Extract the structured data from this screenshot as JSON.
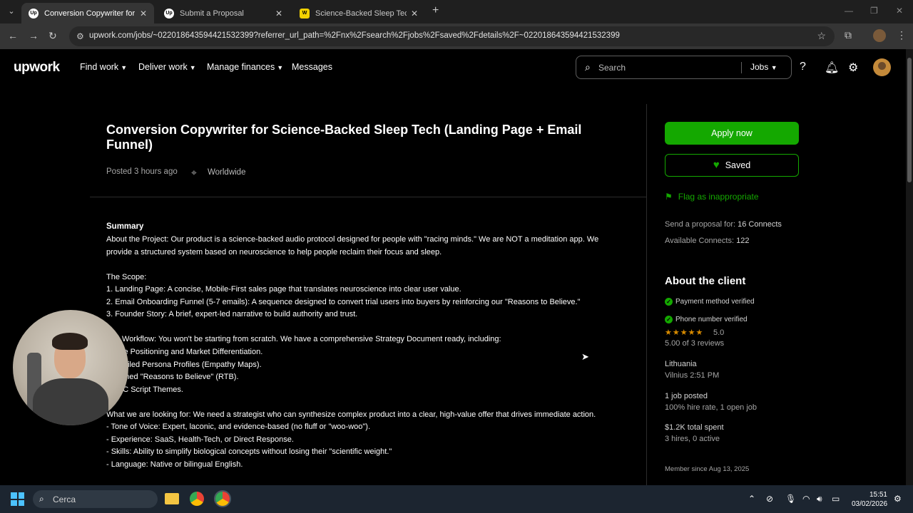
{
  "browser": {
    "tabs": [
      {
        "title": "Conversion Copywriter for Scie",
        "favicon": "Up",
        "active": true
      },
      {
        "title": "Submit a Proposal",
        "favicon": "Up",
        "active": false
      },
      {
        "title": "Science-Backed Sleep Tech Cop",
        "favicon": "W",
        "active": false
      }
    ],
    "url": "upwork.com/jobs/~022018643594421532399?referrer_url_path=%2Fnx%2Fsearch%2Fjobs%2Fsaved%2Fdetails%2F~022018643594421532399"
  },
  "header": {
    "logo": "upwork",
    "nav": [
      "Find work",
      "Deliver work",
      "Manage finances",
      "Messages"
    ],
    "search_placeholder": "Search",
    "search_scope": "Jobs"
  },
  "job": {
    "title": "Conversion Copywriter for Science-Backed Sleep Tech (Landing Page + Email Funnel)",
    "posted": "Posted 3 hours ago",
    "location": "Worldwide",
    "summary_heading": "Summary",
    "lines": [
      "About the Project: Our product is a science-backed audio protocol designed for people with \"racing minds.\" We are NOT a meditation app. We",
      "provide a structured system based on neuroscience to help people reclaim their focus and sleep.",
      "",
      "The Scope:",
      "1. Landing Page: A concise, Mobile-First sales page that translates neuroscience into clear user value.",
      "2. Email Onboarding Funnel (5-7 emails): A sequence designed to convert trial users into buyers by reinforcing our \"Reasons to Believe.\"",
      "3. Founder Story: A brief, expert-led narrative to build authority and trust.",
      "",
      "The Workflow: You won't be starting from scratch. We have a comprehensive Strategy Document ready, including:",
      "- Core Positioning and Market Differentiation.",
      "- Detailed Persona Profiles (Empathy Maps).",
      "- Defined \"Reasons to Believe\" (RTB).",
      "- UGC Script Themes.",
      "",
      "What we are looking for: We need a strategist who can synthesize complex product into a clear, high-value offer that drives immediate action.",
      "- Tone of Voice: Expert, laconic, and evidence-based (no fluff or \"woo-woo\").",
      "- Experience: SaaS, Health-Tech, or Direct Response.",
      "- Skills: Ability to simplify biological concepts without losing their \"scientific weight.\"",
      "- Language: Native or bilingual English."
    ]
  },
  "sidebar": {
    "apply_label": "Apply now",
    "saved_label": "Saved",
    "flag_label": "Flag as inappropriate",
    "connects_label": "Send a proposal for:",
    "connects_value": "16 Connects",
    "available_label": "Available Connects:",
    "available_value": "122",
    "about_heading": "About the client",
    "payment_verified": "Payment method verified",
    "phone_verified": "Phone number verified",
    "stars": "★★★★★",
    "rating": "5.0",
    "reviews": "5.00 of 3 reviews",
    "country": "Lithuania",
    "city_time": "Vilnius 2:51 PM",
    "jobs_posted": "1 job posted",
    "hire_rate": "100% hire rate, 1 open job",
    "total_spent": "$1.2K total spent",
    "hires": "3 hires, 0 active",
    "member_since": "Member since Aug 13, 2025"
  },
  "taskbar": {
    "search_label": "Cerca",
    "time": "15:51",
    "date": "03/02/2026"
  },
  "colors": {
    "brand_green": "#14a800",
    "star_orange": "#d88b00"
  }
}
